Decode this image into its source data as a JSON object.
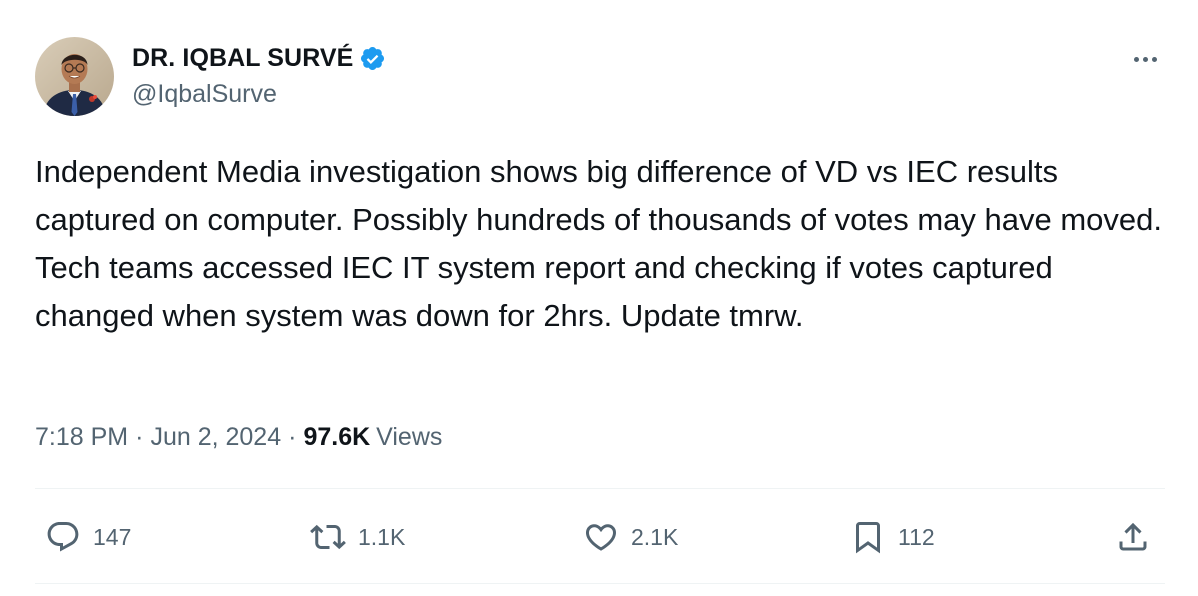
{
  "author": {
    "display_name": "DR. IQBAL SURVÉ",
    "handle": "@IqbalSurve",
    "verified": true,
    "verified_color": "#1d9bf0"
  },
  "tweet": {
    "text": "Independent Media investigation shows big difference of VD vs IEC results captured on computer. Possibly hundreds of thousands of votes may have moved. Tech teams accessed IEC IT system report and checking if votes captured changed when system was down for 2hrs. Update tmrw.",
    "time": "7:18 PM",
    "date": "Jun 2, 2024",
    "views_count": "97.6K",
    "views_label": "Views"
  },
  "actions": {
    "replies": "147",
    "reposts": "1.1K",
    "likes": "2.1K",
    "bookmarks": "112"
  },
  "icons": {
    "more": "more-horizontal-icon",
    "reply": "reply-icon",
    "repost": "repost-icon",
    "like": "heart-icon",
    "bookmark": "bookmark-icon",
    "share": "share-icon",
    "verified": "verified-badge-icon"
  },
  "colors": {
    "text_primary": "#0f1419",
    "text_secondary": "#536471",
    "divider": "#eff3f4"
  }
}
